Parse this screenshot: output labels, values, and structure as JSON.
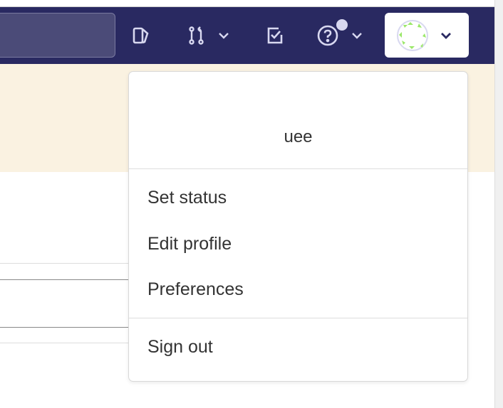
{
  "user": {
    "username_fragment": "uee"
  },
  "menu": {
    "items": [
      {
        "label": "Set status"
      },
      {
        "label": "Edit profile"
      },
      {
        "label": "Preferences"
      }
    ],
    "sign_out": "Sign out"
  },
  "colors": {
    "navbar": "#292961",
    "banner": "#faf2e1"
  }
}
